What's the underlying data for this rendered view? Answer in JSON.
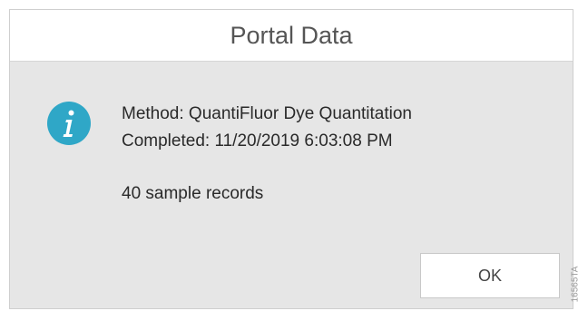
{
  "dialog": {
    "title": "Portal Data",
    "icon": "info-icon",
    "icon_color": "#2fa7c7",
    "messages": {
      "method": "Method: QuantiFluor Dye Quantitation",
      "completed": "Completed: 11/20/2019 6:03:08 PM",
      "records": "40 sample records"
    },
    "ok_label": "OK"
  },
  "watermark": "16565TA"
}
